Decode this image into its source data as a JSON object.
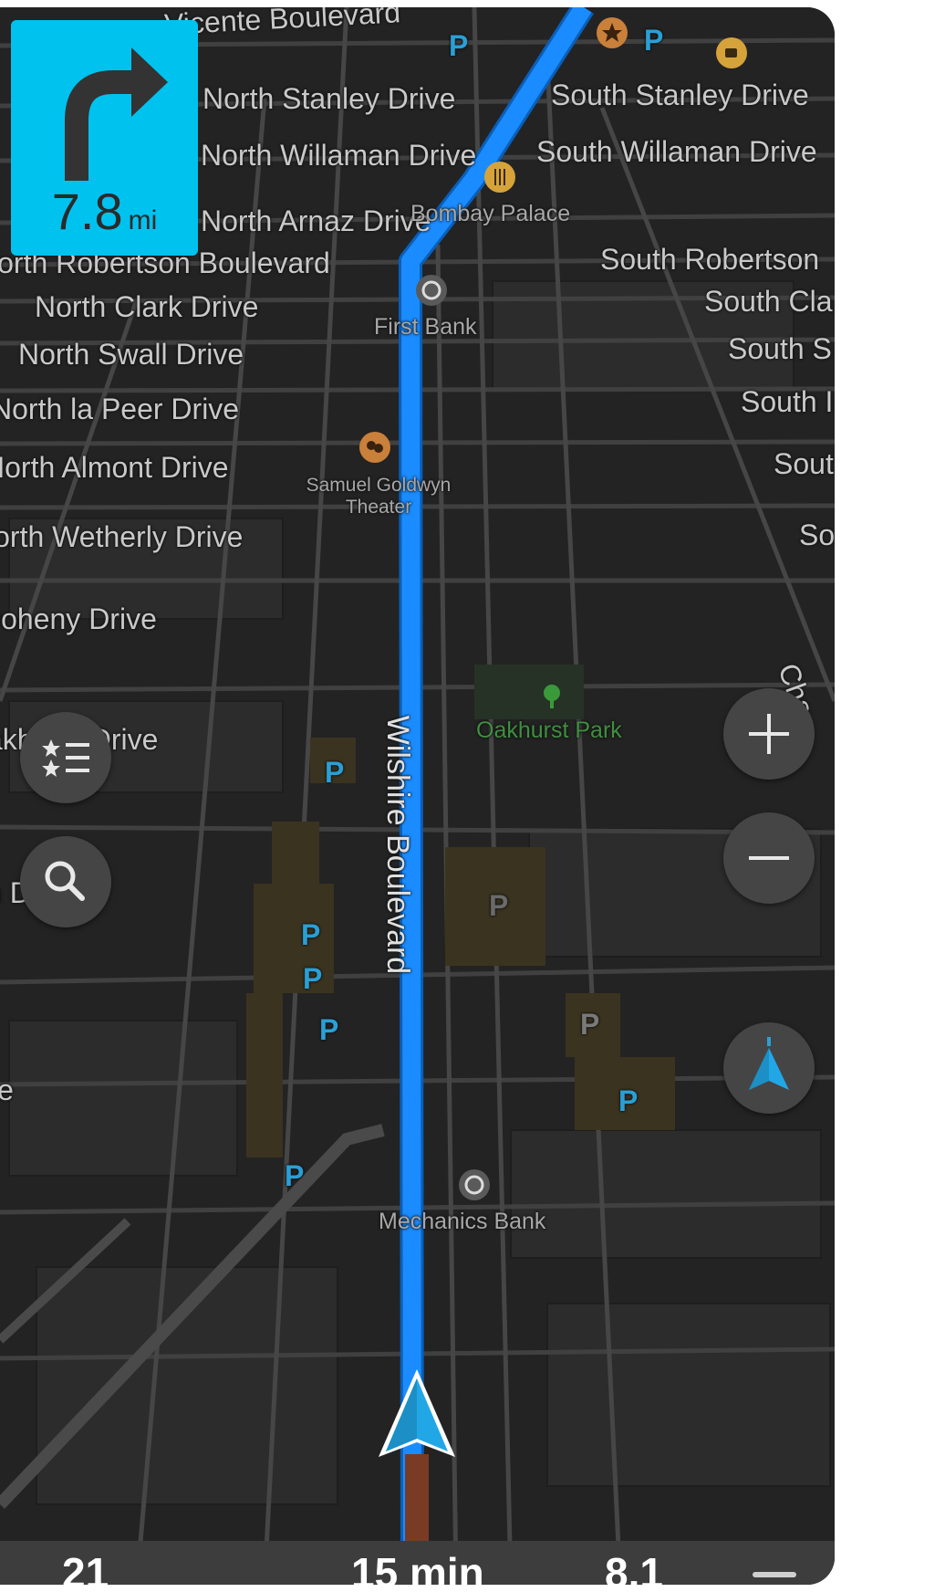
{
  "turn_instruction": {
    "distance": "7.8",
    "unit": "mi"
  },
  "map": {
    "streets_left": [
      "Vicente Boulevard",
      "North Stanley Drive",
      "North Willaman Drive",
      "North Arnaz Drive",
      "North Robertson Boulevard",
      "North Clark Drive",
      "North Swall Drive",
      "North la Peer Drive",
      "North Almont Drive",
      "North Wetherly Drive",
      "Doheny Drive",
      "Oakhurst Drive",
      "n Drive",
      "ive"
    ],
    "streets_right": [
      "South Stanley Drive",
      "South Willaman Drive",
      "South Robertson",
      "South Cla",
      "South S",
      "South I",
      "Sout",
      "So",
      "Cha"
    ],
    "route_street": "Wilshire Boulevard",
    "pois": {
      "restaurant": "Bombay Palace",
      "bank_1": "First Bank",
      "theater": "Samuel Goldwyn Theater",
      "park": "Oakhurst Park",
      "bank_2": "Mechanics Bank"
    },
    "parking_symbol": "P"
  },
  "controls": {
    "favorites_icon": "star-list-icon",
    "search_icon": "search-icon",
    "zoom_in_icon": "plus-icon",
    "zoom_out_icon": "minus-icon",
    "compass_icon": "north-arrow-icon"
  },
  "trip_bar": {
    "arrival_time": "21",
    "remaining_time": "15 min",
    "remaining_distance": "8.1"
  },
  "colors": {
    "route": "#1a8cff",
    "turn_card": "#00c2ef",
    "map_background": "#222222",
    "position_arrow": "#22a7e6"
  }
}
